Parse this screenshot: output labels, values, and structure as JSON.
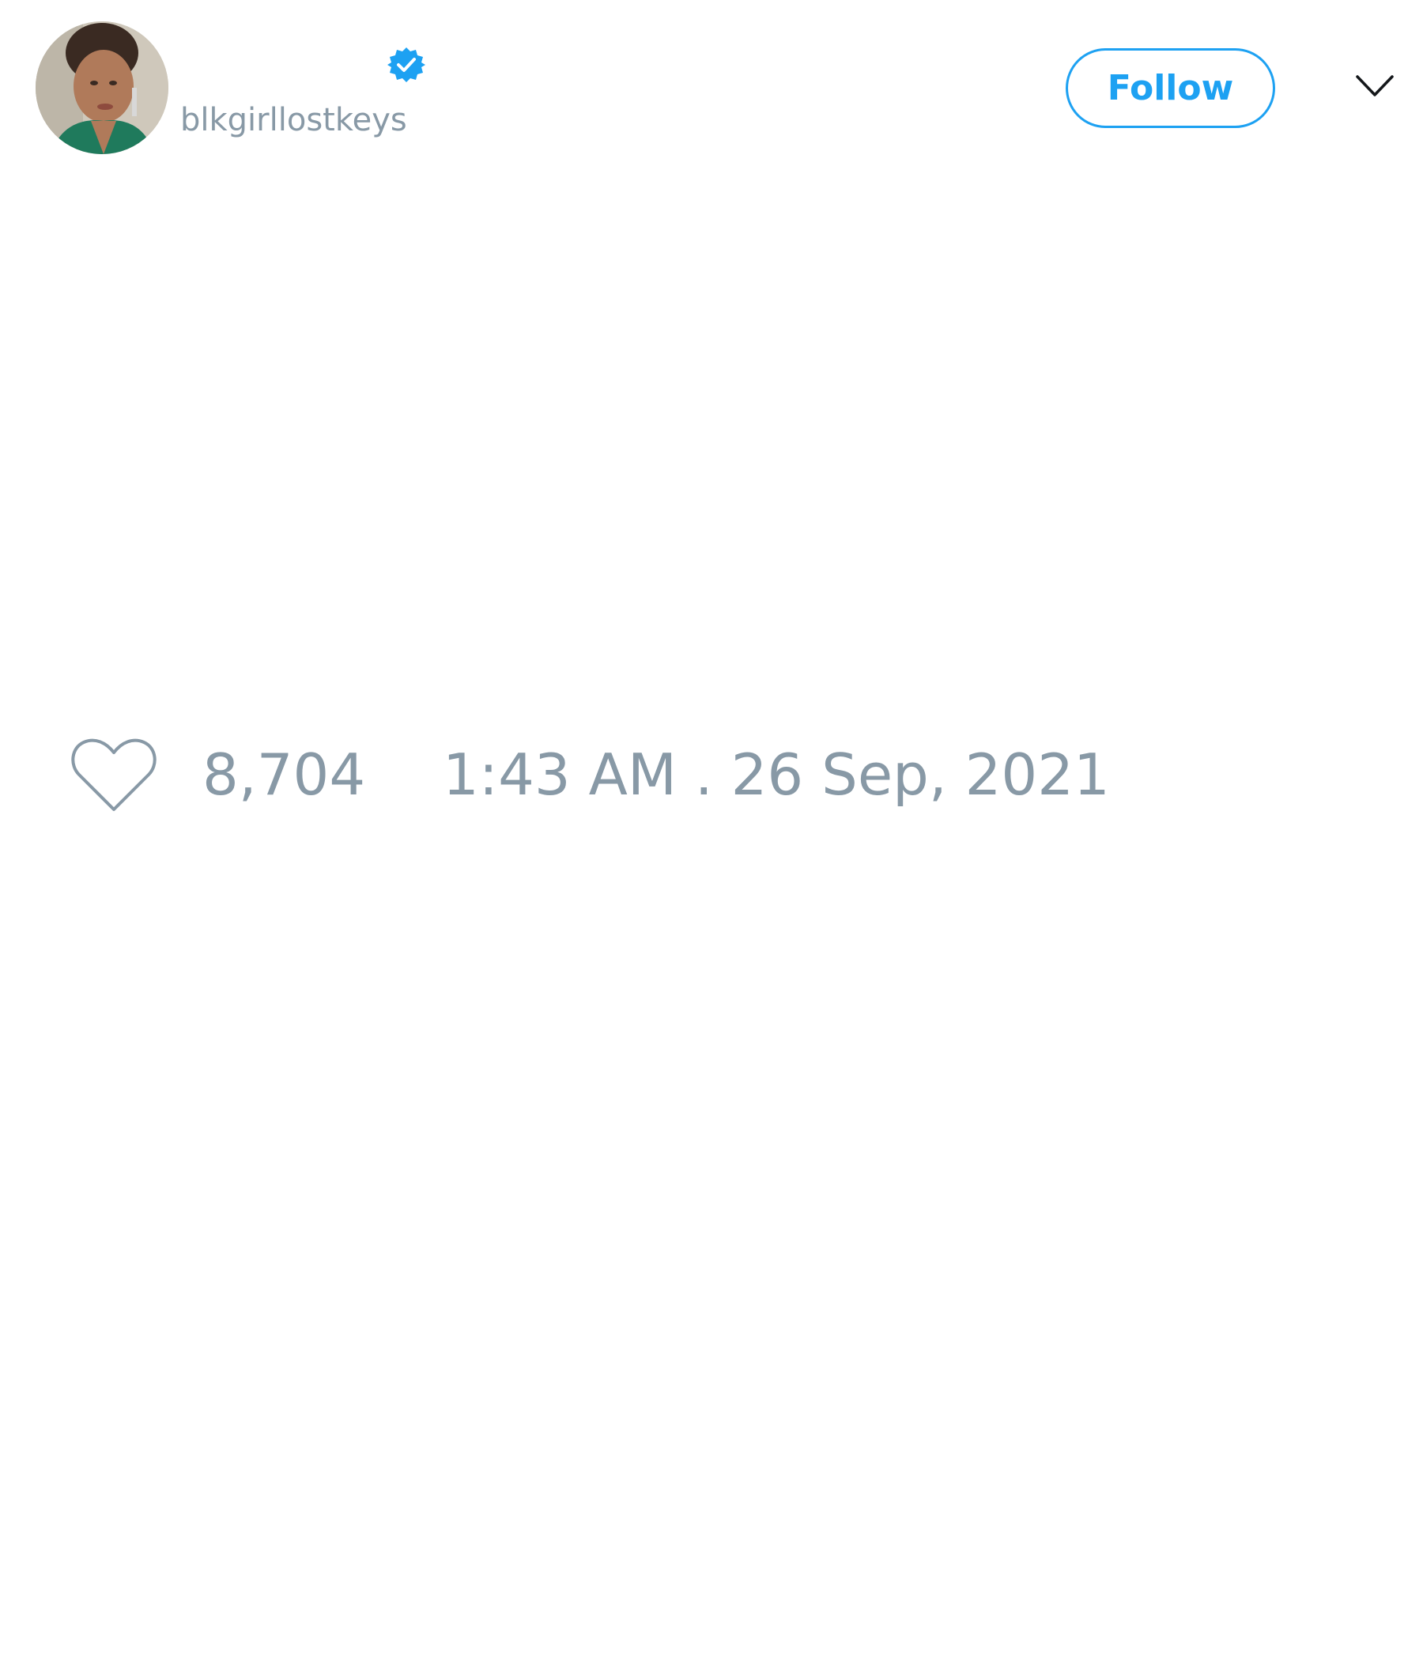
{
  "author": {
    "handle": "blkgirllostkeys",
    "verified": true,
    "avatar": "profile-photo"
  },
  "header": {
    "follow_label": "Follow",
    "menu_icon": "chevron-down-icon"
  },
  "engagement": {
    "like_icon": "heart-icon",
    "like_count": "8,704",
    "timestamp": "1:43 AM . 26 Sep, 2021"
  },
  "colors": {
    "accent": "#1da1f2",
    "muted": "#8899a6",
    "icon_dark": "#14171a",
    "background": "#ffffff"
  }
}
